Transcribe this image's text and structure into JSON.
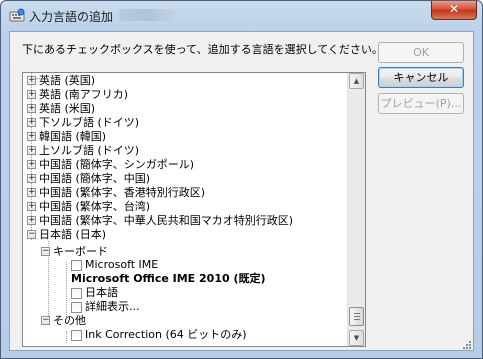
{
  "window": {
    "title": "入力言語の追加",
    "close_label": "✕"
  },
  "dialog": {
    "instruction": "下にあるチェックボックスを使って、追加する言語を選択してください。"
  },
  "buttons": {
    "ok": "OK",
    "cancel": "キャンセル",
    "preview": "プレビュー(P)..."
  },
  "languages": [
    {
      "label": "英語 (英国)"
    },
    {
      "label": "英語 (南アフリカ)"
    },
    {
      "label": "英語 (米国)"
    },
    {
      "label": "下ソルブ語 (ドイツ)"
    },
    {
      "label": "韓国語 (韓国)"
    },
    {
      "label": "上ソルブ語 (ドイツ)"
    },
    {
      "label": "中国語 (簡体字、シンガポール)"
    },
    {
      "label": "中国語 (簡体字、中国)"
    },
    {
      "label": "中国語 (繁体字、香港特別行政区)"
    },
    {
      "label": "中国語 (繁体字、台湾)"
    },
    {
      "label": "中国語 (繁体字、中華人民共和国マカオ特別行政区)"
    },
    {
      "label": "日本語 (日本)"
    }
  ],
  "japanese": {
    "keyboard_group": "キーボード",
    "keyboard_items": [
      {
        "label": "Microsoft IME",
        "checked": false
      },
      {
        "label": "Microsoft Office IME 2010 (既定)",
        "checked": true,
        "bold": true
      },
      {
        "label": "日本語",
        "checked": false
      },
      {
        "label": "詳細表示...",
        "checked": false
      }
    ],
    "other_group": "その他",
    "other_items": [
      {
        "label": "Ink Correction (64 ビットのみ)",
        "checked": false
      }
    ]
  }
}
